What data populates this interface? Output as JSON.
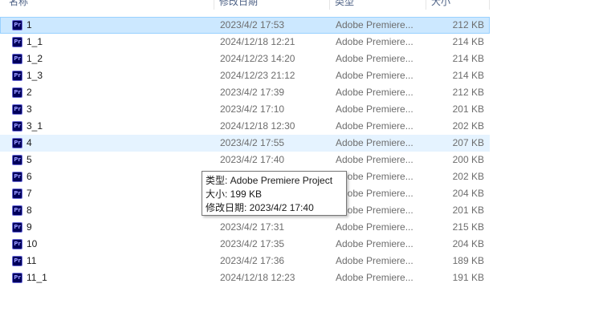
{
  "columns": {
    "name": "名称",
    "date": "修改日期",
    "type": "类型",
    "size": "大小"
  },
  "files": [
    {
      "name": "1",
      "date": "2023/4/2 17:53",
      "type": "Adobe Premiere...",
      "size": "212 KB",
      "state": "selected"
    },
    {
      "name": "1_1",
      "date": "2024/12/18 12:21",
      "type": "Adobe Premiere...",
      "size": "214 KB",
      "state": ""
    },
    {
      "name": "1_2",
      "date": "2024/12/23 14:20",
      "type": "Adobe Premiere...",
      "size": "214 KB",
      "state": ""
    },
    {
      "name": "1_3",
      "date": "2024/12/23 21:12",
      "type": "Adobe Premiere...",
      "size": "214 KB",
      "state": ""
    },
    {
      "name": "2",
      "date": "2023/4/2 17:39",
      "type": "Adobe Premiere...",
      "size": "212 KB",
      "state": ""
    },
    {
      "name": "3",
      "date": "2023/4/2 17:10",
      "type": "Adobe Premiere...",
      "size": "201 KB",
      "state": ""
    },
    {
      "name": "3_1",
      "date": "2024/12/18 12:30",
      "type": "Adobe Premiere...",
      "size": "202 KB",
      "state": ""
    },
    {
      "name": "4",
      "date": "2023/4/2 17:55",
      "type": "Adobe Premiere...",
      "size": "207 KB",
      "state": "hover"
    },
    {
      "name": "5",
      "date": "2023/4/2 17:40",
      "type": "Adobe Premiere...",
      "size": "200 KB",
      "state": ""
    },
    {
      "name": "6",
      "date": "",
      "type": "Adobe Premiere...",
      "size": "202 KB",
      "state": ""
    },
    {
      "name": "7",
      "date": "",
      "type": "Adobe Premiere...",
      "size": "204 KB",
      "state": ""
    },
    {
      "name": "8",
      "date": "",
      "type": "Adobe Premiere...",
      "size": "201 KB",
      "state": ""
    },
    {
      "name": "9",
      "date": "2023/4/2 17:31",
      "type": "Adobe Premiere...",
      "size": "215 KB",
      "state": ""
    },
    {
      "name": "10",
      "date": "2023/4/2 17:35",
      "type": "Adobe Premiere...",
      "size": "204 KB",
      "state": ""
    },
    {
      "name": "11",
      "date": "2023/4/2 17:36",
      "type": "Adobe Premiere...",
      "size": "189 KB",
      "state": ""
    },
    {
      "name": "11_1",
      "date": "2024/12/18 12:23",
      "type": "Adobe Premiere...",
      "size": "191 KB",
      "state": ""
    }
  ],
  "file_icon": {
    "name": "premiere-pro-file-icon",
    "text": "Pr"
  },
  "tooltip": {
    "type_line": "类型: Adobe Premiere Project",
    "size_line": "大小: 199 KB",
    "date_line": "修改日期: 2023/4/2 17:40"
  },
  "colors": {
    "selected_bg": "#cce8ff",
    "hover_bg": "#e5f3ff",
    "premiere_icon": "#00005b"
  }
}
